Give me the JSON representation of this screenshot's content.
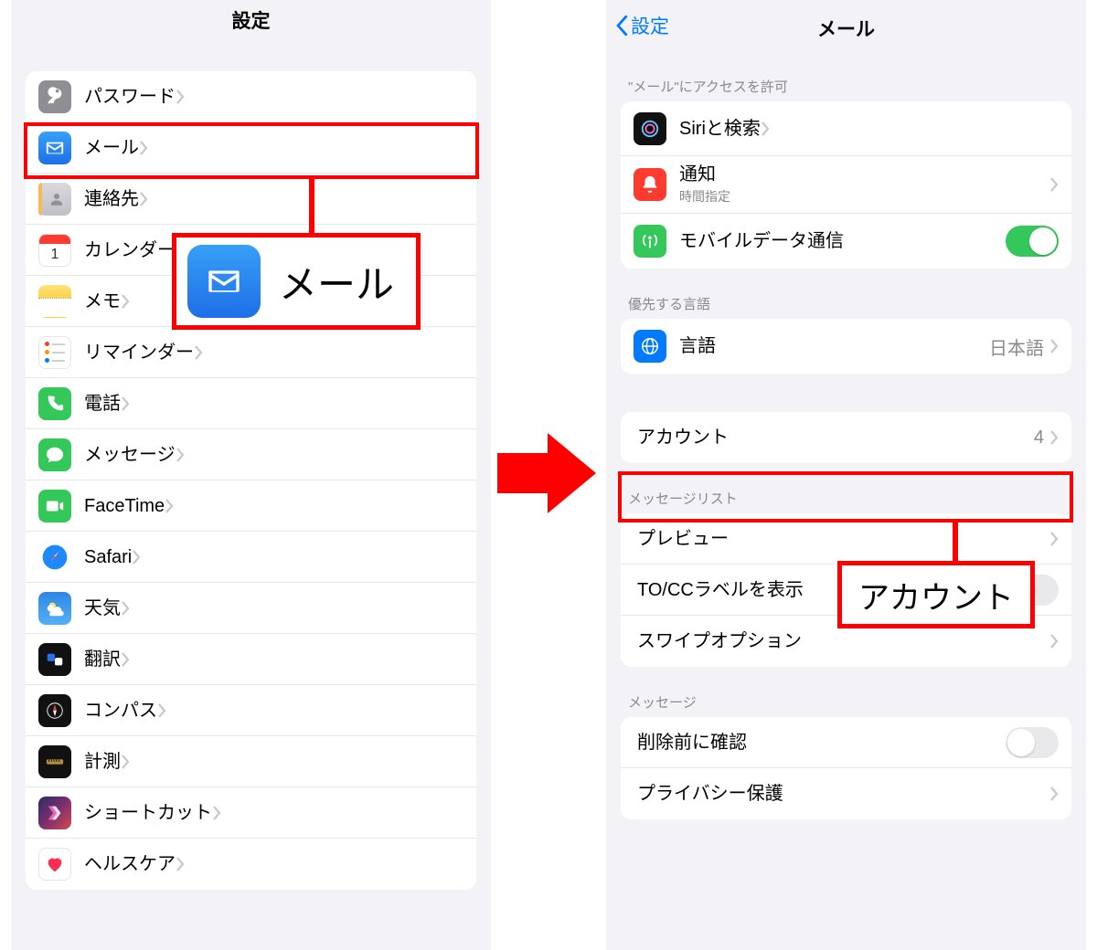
{
  "left": {
    "title": "設定",
    "items": [
      {
        "label": "パスワード"
      },
      {
        "label": "メール"
      },
      {
        "label": "連絡先"
      },
      {
        "label": "カレンダー"
      },
      {
        "label": "メモ"
      },
      {
        "label": "リマインダー"
      },
      {
        "label": "電話"
      },
      {
        "label": "メッセージ"
      },
      {
        "label": "FaceTime"
      },
      {
        "label": "Safari"
      },
      {
        "label": "天気"
      },
      {
        "label": "翻訳"
      },
      {
        "label": "コンパス"
      },
      {
        "label": "計測"
      },
      {
        "label": "ショートカット"
      },
      {
        "label": "ヘルスケア"
      }
    ]
  },
  "right": {
    "back": "設定",
    "title": "メール",
    "section_access": "\"メール\"にアクセスを許可",
    "rows_access": {
      "siri": "Siriと検索",
      "notif": "通知",
      "notif_sub": "時間指定",
      "cellular": "モバイルデータ通信"
    },
    "section_lang": "優先する言語",
    "rows_lang": {
      "language": "言語",
      "language_value": "日本語"
    },
    "rows_account": {
      "account": "アカウント",
      "account_value": "4"
    },
    "section_msglist": "メッセージリスト",
    "rows_msglist": {
      "preview": "プレビュー",
      "tocc": "TO/CCラベルを表示",
      "swipe": "スワイプオプション"
    },
    "section_msg": "メッセージ",
    "rows_msg": {
      "confirm": "削除前に確認",
      "privacy": "プライバシー保護"
    }
  },
  "callouts": {
    "mail": "メール",
    "account": "アカウント"
  }
}
